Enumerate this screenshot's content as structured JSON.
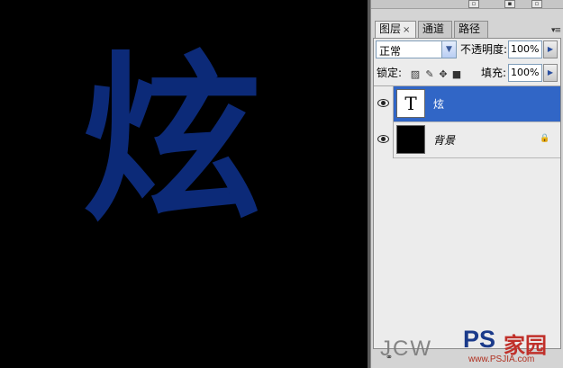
{
  "canvas": {
    "glyph": "炫",
    "glyph_color": "#0c2a78",
    "background_color": "#000000"
  },
  "panel": {
    "tabs": [
      {
        "label": "图层",
        "active": true
      },
      {
        "label": "通道",
        "active": false
      },
      {
        "label": "路径",
        "active": false
      }
    ],
    "tab_close": "×",
    "menu_icon": "▾≡",
    "blend_mode": {
      "value": "正常"
    },
    "opacity": {
      "label": "不透明度:",
      "value": "100%"
    },
    "lock": {
      "label": "锁定:",
      "icons": [
        "lock-transparent-icon",
        "lock-paint-icon",
        "lock-move-icon",
        "lock-all-icon"
      ]
    },
    "fill": {
      "label": "填充:",
      "value": "100%"
    },
    "layers": [
      {
        "name": "炫",
        "type": "text",
        "thumb_label": "T",
        "selected": true,
        "visible": true,
        "locked": false
      },
      {
        "name": "背景",
        "type": "background",
        "selected": false,
        "visible": true,
        "locked": true
      }
    ],
    "selection_color": "#3166c6",
    "footer_icons": [
      "link-layers-icon"
    ]
  },
  "watermark": {
    "left_text": "JCW",
    "logo_text": "PS",
    "logo_cn": "家园",
    "url": "www.PSJIA.com"
  }
}
